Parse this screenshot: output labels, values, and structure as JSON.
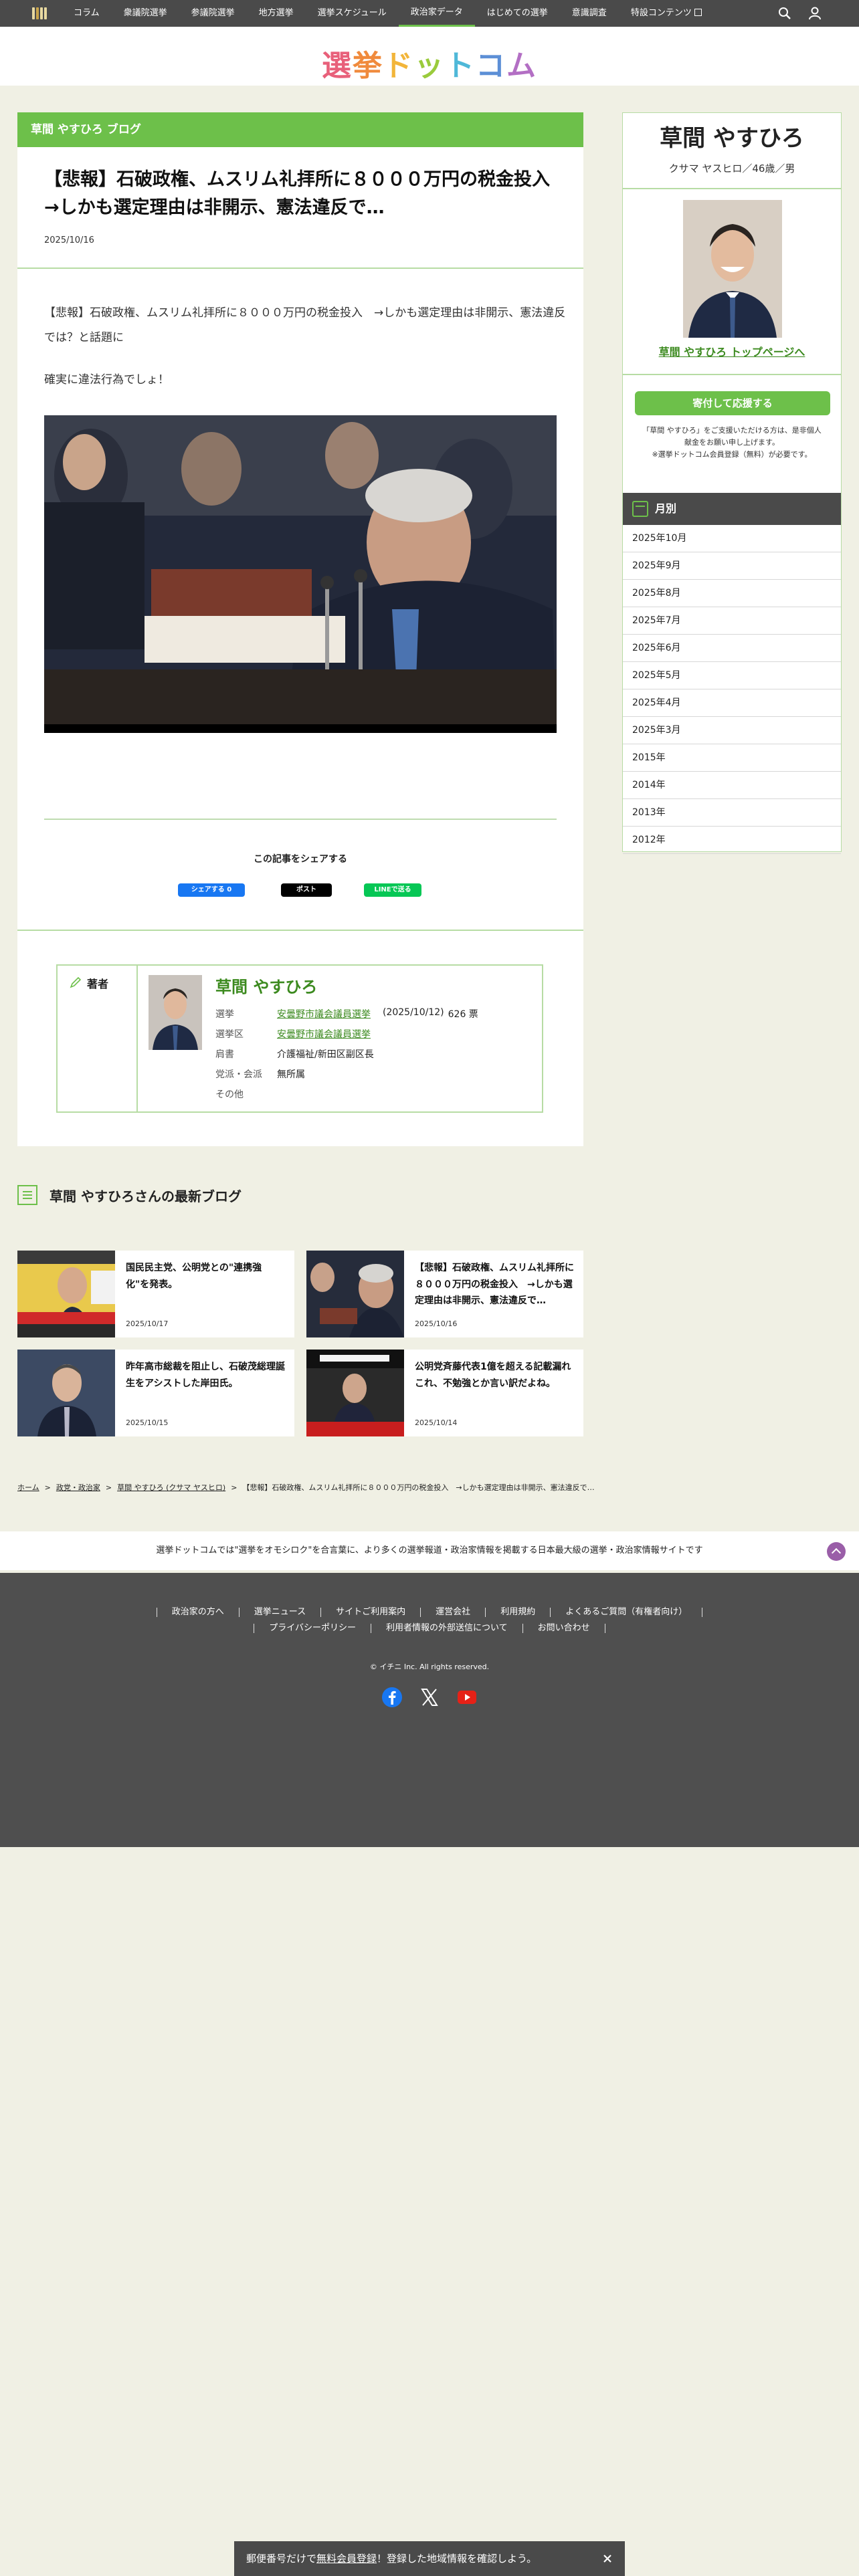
{
  "nav": {
    "items": [
      "コラム",
      "衆議院選挙",
      "参議院選挙",
      "地方選挙",
      "選挙スケジュール",
      "政治家データ",
      "はじめての選挙",
      "意識調査",
      "特設コンテンツ"
    ],
    "active_index": 5
  },
  "logo": {
    "chars": [
      "選",
      "挙",
      "ド",
      "ッ",
      "ト",
      "コ",
      "ム"
    ],
    "colors": [
      "#e8607a",
      "#f08a3c",
      "#f2b53a",
      "#9acb3c",
      "#4fb8d8",
      "#5c8fd6",
      "#b36fc4"
    ]
  },
  "article": {
    "blog_header": "草間 やすひろ ブログ",
    "title": "【悲報】石破政権、ムスリム礼拝所に８０００万円の税金投入　→しかも選定理由は非開示、憲法違反で…",
    "date": "2025/10/16",
    "body_line1": "【悲報】石破政権、ムスリム礼拝所に８０００万円の税金投入　→しかも選定理由は非開示、憲法違反では？と話題に",
    "body_line2": "確実に違法行為でしょ！",
    "share_title": "この記事をシェアする",
    "share_facebook": "シェアする 0",
    "share_x": "ポスト",
    "share_line": "LINEで送る"
  },
  "author": {
    "label": "著者",
    "name": "草間 やすひろ",
    "election_k": "選挙",
    "election_v": "安曇野市議会議員選挙",
    "election_date": "(2025/10/12)",
    "election_votes": "626 票",
    "district_k": "選挙区",
    "district_v": "安曇野市議会議員選挙",
    "title_k": "肩書",
    "title_v": "介護福祉/新田区副区長",
    "party_k": "党派・会派",
    "party_v": "無所属",
    "other_k": "その他"
  },
  "latest": {
    "title": "草間 やすひろさんの最新ブログ",
    "cards": [
      {
        "title": "国民民主党、公明党との\"連携強化\"を発表。",
        "date": "2025/10/17"
      },
      {
        "title": "【悲報】石破政権、ムスリム礼拝所に８０００万円の税金投入　→しかも選定理由は非開示、憲法違反で…",
        "date": "2025/10/16"
      },
      {
        "title": "昨年高市総裁を阻止し、石破茂総理誕生をアシストした岸田氏。",
        "date": "2025/10/15"
      },
      {
        "title": "公明党斉藤代表1億を超える記載漏れ これ、不勉強とか言い訳だよね。",
        "date": "2025/10/14"
      }
    ]
  },
  "breadcrumb": {
    "home": "ホーム",
    "politics": "政党・政治家",
    "person": "草間 やすひろ (クサマ ヤスヒロ)",
    "current": "【悲報】石破政権、ムスリム礼拝所に８０００万円の税金投入　→しかも選定理由は非開示、憲法違反で…"
  },
  "sidebar": {
    "name": "草間 やすひろ",
    "kana": "クサマ ヤスヒロ／46歳／男",
    "top_link": "草間 やすひろ トップページへ",
    "donate": "寄付して応援する",
    "note1": "「草間 やすひろ」をご支援いただける方は、是非個人",
    "note2": "献金をお願い申し上げます。",
    "note3": "※選挙ドットコム会員登録（無料）が必要です。",
    "month_head": "月別",
    "months": [
      "2025年10月",
      "2025年9月",
      "2025年8月",
      "2025年7月",
      "2025年6月",
      "2025年5月",
      "2025年4月",
      "2025年3月",
      "2015年",
      "2014年",
      "2013年",
      "2012年"
    ]
  },
  "tagline": "選挙ドットコムでは\"選挙をオモシロク\"を合言葉に、より多くの選挙報道・政治家情報を掲載する日本最大級の選挙・政治家情報サイトです",
  "footer": {
    "row1": [
      "政治家の方へ",
      "選挙ニュース",
      "サイトご利用案内",
      "運営会社",
      "利用規約",
      "よくあるご質問（有権者向け）"
    ],
    "row2": [
      "プライバシーポリシー",
      "利用者情報の外部送信について",
      "お問い合わせ"
    ],
    "copyright": "© イチニ Inc. All rights reserved."
  },
  "banner": {
    "pre": "郵便番号だけで",
    "link": "無料会員登録",
    "post": "！登録した地域情報を確認しよう。"
  },
  "colors": {
    "accent": "#6dc04a",
    "nav": "#4a4a4a",
    "footer": "#4f4f4f"
  }
}
